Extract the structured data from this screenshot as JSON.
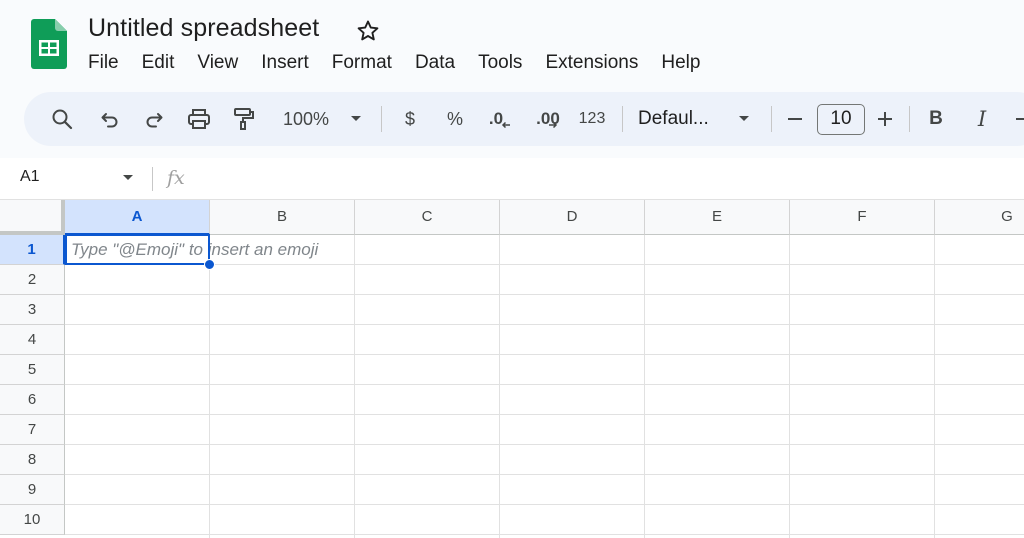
{
  "header": {
    "title": "Untitled spreadsheet",
    "menu": [
      "File",
      "Edit",
      "View",
      "Insert",
      "Format",
      "Data",
      "Tools",
      "Extensions",
      "Help"
    ]
  },
  "toolbar": {
    "zoom": "100%",
    "currency": "$",
    "percent": "%",
    "decrease_decimal": ".0",
    "increase_decimal": ".00",
    "number_format": "123",
    "font": "Defaul...",
    "font_size": "10",
    "bold": "B",
    "italic": "I"
  },
  "formula_bar": {
    "name_box": "A1",
    "fx": "fx"
  },
  "grid": {
    "columns": [
      "A",
      "B",
      "C",
      "D",
      "E",
      "F",
      "G"
    ],
    "rows": [
      "1",
      "2",
      "3",
      "4",
      "5",
      "6",
      "7",
      "8",
      "9",
      "10"
    ],
    "selected_cell": "A1",
    "hint_text": "Type \"@Emoji\" to insert an emoji"
  },
  "colors": {
    "accent": "#0b57d0",
    "selection": "#d3e3fd",
    "sheets_green": "#0f9d58"
  }
}
